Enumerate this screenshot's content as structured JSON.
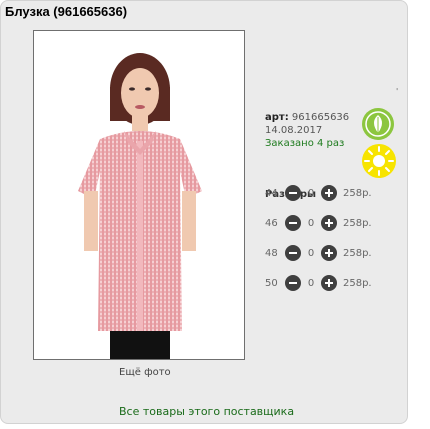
{
  "product": {
    "title": "Блузка (961665636)",
    "more_photo_label": "Ещё фото"
  },
  "info": {
    "art_label": "арт:",
    "art_value": "961665636",
    "date": "14.08.2017",
    "ordered": "Заказано 4 раз"
  },
  "sizes": {
    "title": "Размеры",
    "items": [
      {
        "size": "44",
        "qty": "0",
        "price": "258р."
      },
      {
        "size": "46",
        "qty": "0",
        "price": "258р."
      },
      {
        "size": "48",
        "qty": "0",
        "price": "258р."
      },
      {
        "size": "50",
        "qty": "0",
        "price": "258р."
      }
    ]
  },
  "footer": {
    "supplier_link": "Все товары этого поставщика"
  },
  "icons": {
    "eco": "leaf-icon",
    "season": "sun-icon",
    "decrease": "minus-circle-icon",
    "increase": "plus-circle-icon"
  },
  "colors": {
    "eco_icon": "#8cc63f",
    "sun_icon": "#f7e400",
    "ordered_text": "#1e7b1e",
    "link_text": "#1a6b1a"
  }
}
